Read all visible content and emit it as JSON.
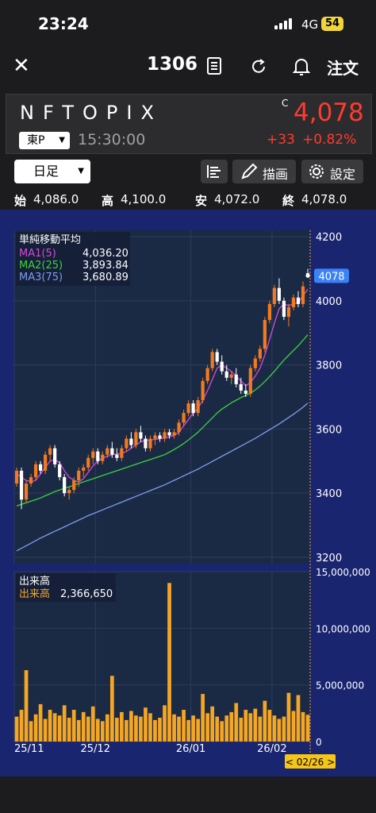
{
  "status_bar": {
    "time": "23:24",
    "network": "4G",
    "battery": "54"
  },
  "nav": {
    "code": "1306",
    "order_label": "注文"
  },
  "quote": {
    "name": "NFTOPIX",
    "market": "東P",
    "time": "15:30:00",
    "flag": "C",
    "price": "4,078",
    "change": "+33",
    "change_pct": "+0.82%"
  },
  "toolbar": {
    "period": "日足",
    "draw_label": "描画",
    "settings_label": "設定"
  },
  "ohlc": {
    "open_label": "始",
    "open": "4,086.0",
    "high_label": "高",
    "high": "4,100.0",
    "low_label": "安",
    "low": "4,072.0",
    "close_label": "終",
    "close": "4,078.0"
  },
  "colors": {
    "up": "#f27a21",
    "down": "#ffffff",
    "ma1": "#d44bd8",
    "ma2": "#3bd43b",
    "ma3": "#7e9cf0",
    "volume": "#f5a623",
    "panel_bg": "#1a2570",
    "current_price": "#3b82f6"
  },
  "chart_data": {
    "type": "candlestick",
    "price_panel": {
      "ylim": [
        3180,
        4220
      ],
      "yticks": [
        "4200",
        "4000",
        "3800",
        "3600",
        "3400",
        "3200"
      ],
      "current_price_label": "4078",
      "legend": {
        "title": "単純移動平均",
        "items": [
          {
            "name": "MA1(5)",
            "value": "4,036.20"
          },
          {
            "name": "MA2(25)",
            "value": "3,893.84"
          },
          {
            "name": "MA3(75)",
            "value": "3,680.89"
          }
        ]
      },
      "candles": [
        [
          3430,
          3480,
          3420,
          3470
        ],
        [
          3470,
          3480,
          3350,
          3380
        ],
        [
          3380,
          3440,
          3370,
          3430
        ],
        [
          3430,
          3460,
          3420,
          3450
        ],
        [
          3450,
          3500,
          3440,
          3490
        ],
        [
          3490,
          3500,
          3460,
          3470
        ],
        [
          3470,
          3530,
          3460,
          3520
        ],
        [
          3520,
          3550,
          3500,
          3540
        ],
        [
          3540,
          3550,
          3480,
          3490
        ],
        [
          3490,
          3500,
          3440,
          3450
        ],
        [
          3450,
          3460,
          3390,
          3400
        ],
        [
          3400,
          3420,
          3380,
          3410
        ],
        [
          3410,
          3450,
          3400,
          3440
        ],
        [
          3440,
          3480,
          3420,
          3470
        ],
        [
          3470,
          3490,
          3450,
          3480
        ],
        [
          3480,
          3520,
          3470,
          3510
        ],
        [
          3510,
          3540,
          3490,
          3530
        ],
        [
          3530,
          3540,
          3490,
          3500
        ],
        [
          3500,
          3530,
          3490,
          3520
        ],
        [
          3520,
          3550,
          3510,
          3540
        ],
        [
          3540,
          3560,
          3510,
          3520
        ],
        [
          3520,
          3540,
          3500,
          3510
        ],
        [
          3510,
          3550,
          3500,
          3540
        ],
        [
          3540,
          3580,
          3530,
          3570
        ],
        [
          3570,
          3590,
          3540,
          3550
        ],
        [
          3550,
          3600,
          3540,
          3590
        ],
        [
          3590,
          3610,
          3560,
          3570
        ],
        [
          3570,
          3580,
          3530,
          3540
        ],
        [
          3540,
          3580,
          3530,
          3570
        ],
        [
          3570,
          3590,
          3550,
          3580
        ],
        [
          3580,
          3590,
          3560,
          3570
        ],
        [
          3570,
          3600,
          3560,
          3590
        ],
        [
          3590,
          3600,
          3570,
          3580
        ],
        [
          3580,
          3600,
          3570,
          3590
        ],
        [
          3590,
          3630,
          3580,
          3620
        ],
        [
          3620,
          3660,
          3610,
          3650
        ],
        [
          3650,
          3690,
          3640,
          3680
        ],
        [
          3680,
          3690,
          3640,
          3650
        ],
        [
          3650,
          3700,
          3640,
          3690
        ],
        [
          3690,
          3760,
          3680,
          3750
        ],
        [
          3750,
          3800,
          3740,
          3790
        ],
        [
          3790,
          3850,
          3780,
          3840
        ],
        [
          3840,
          3850,
          3800,
          3810
        ],
        [
          3810,
          3830,
          3770,
          3780
        ],
        [
          3780,
          3800,
          3750,
          3760
        ],
        [
          3760,
          3780,
          3740,
          3770
        ],
        [
          3770,
          3790,
          3730,
          3740
        ],
        [
          3740,
          3760,
          3710,
          3720
        ],
        [
          3720,
          3740,
          3700,
          3710
        ],
        [
          3710,
          3800,
          3700,
          3790
        ],
        [
          3790,
          3830,
          3780,
          3820
        ],
        [
          3820,
          3860,
          3810,
          3850
        ],
        [
          3850,
          3950,
          3840,
          3940
        ],
        [
          3940,
          4000,
          3930,
          3990
        ],
        [
          3990,
          4050,
          3980,
          4040
        ],
        [
          4040,
          4070,
          3990,
          4000
        ],
        [
          4000,
          4010,
          3940,
          3950
        ],
        [
          3950,
          3990,
          3920,
          3980
        ],
        [
          3980,
          4020,
          3970,
          4010
        ],
        [
          4010,
          4030,
          3980,
          3990
        ],
        [
          3990,
          4060,
          3980,
          4045
        ],
        [
          4086,
          4100,
          4072,
          4078
        ]
      ],
      "ma1": [
        3460,
        3450,
        3440,
        3435,
        3440,
        3460,
        3480,
        3500,
        3505,
        3495,
        3470,
        3450,
        3440,
        3435,
        3445,
        3465,
        3485,
        3500,
        3510,
        3515,
        3520,
        3522,
        3524,
        3530,
        3540,
        3550,
        3560,
        3565,
        3565,
        3568,
        3570,
        3572,
        3576,
        3580,
        3590,
        3610,
        3630,
        3650,
        3665,
        3690,
        3720,
        3755,
        3790,
        3800,
        3790,
        3780,
        3765,
        3750,
        3735,
        3745,
        3765,
        3790,
        3830,
        3880,
        3930,
        3975,
        3990,
        3985,
        3990,
        3995,
        4015,
        4036.2
      ],
      "ma2": [
        3360,
        3365,
        3370,
        3375,
        3380,
        3385,
        3392,
        3398,
        3405,
        3410,
        3415,
        3420,
        3425,
        3430,
        3435,
        3440,
        3445,
        3450,
        3455,
        3460,
        3465,
        3470,
        3475,
        3480,
        3485,
        3490,
        3495,
        3500,
        3505,
        3510,
        3515,
        3520,
        3528,
        3536,
        3545,
        3555,
        3566,
        3578,
        3590,
        3605,
        3620,
        3635,
        3650,
        3662,
        3672,
        3682,
        3690,
        3698,
        3705,
        3712,
        3722,
        3734,
        3748,
        3764,
        3780,
        3798,
        3815,
        3830,
        3845,
        3860,
        3877,
        3893.84
      ],
      "ma3": [
        3220,
        3228,
        3236,
        3244,
        3252,
        3260,
        3267,
        3274,
        3281,
        3288,
        3295,
        3302,
        3309,
        3316,
        3323,
        3330,
        3336,
        3342,
        3348,
        3354,
        3360,
        3366,
        3372,
        3378,
        3384,
        3390,
        3396,
        3402,
        3408,
        3414,
        3420,
        3426,
        3433,
        3440,
        3447,
        3454,
        3461,
        3468,
        3475,
        3483,
        3491,
        3499,
        3507,
        3515,
        3523,
        3531,
        3539,
        3547,
        3555,
        3563,
        3571,
        3580,
        3589,
        3598,
        3607,
        3616,
        3626,
        3636,
        3646,
        3657,
        3668,
        3680.89
      ]
    },
    "volume_panel": {
      "ylim": [
        0,
        15000000
      ],
      "yticks": [
        "15,000,000",
        "10,000,000",
        "5,000,000",
        "0"
      ],
      "legend": {
        "title": "出来高",
        "name": "出来高",
        "value": "2,366,650"
      },
      "values": [
        2200000,
        2800000,
        6300000,
        1800000,
        2400000,
        3300000,
        2000000,
        2800000,
        2500000,
        2300000,
        3200000,
        2100000,
        2800000,
        1900000,
        2600000,
        2200000,
        3100000,
        2000000,
        1800000,
        2400000,
        5800000,
        2100000,
        2600000,
        1900000,
        2700000,
        2300000,
        2200000,
        3000000,
        2500000,
        1900000,
        2100000,
        3200000,
        14000000,
        2400000,
        2200000,
        2800000,
        1900000,
        2300000,
        2000000,
        4200000,
        2500000,
        3100000,
        2200000,
        1800000,
        2300000,
        2600000,
        3400000,
        2100000,
        2800000,
        2500000,
        2900000,
        2200000,
        3600000,
        2800000,
        2300000,
        2000000,
        2200000,
        4300000,
        2700000,
        4100000,
        2600000,
        2366650
      ]
    },
    "x_ticks": [
      {
        "label": "25/11",
        "index": 0
      },
      {
        "label": "25/12",
        "index": 17
      },
      {
        "label": "26/01",
        "index": 37
      },
      {
        "label": "26/02",
        "index": 54
      }
    ],
    "crosshair_label": "< 02/26 >"
  }
}
